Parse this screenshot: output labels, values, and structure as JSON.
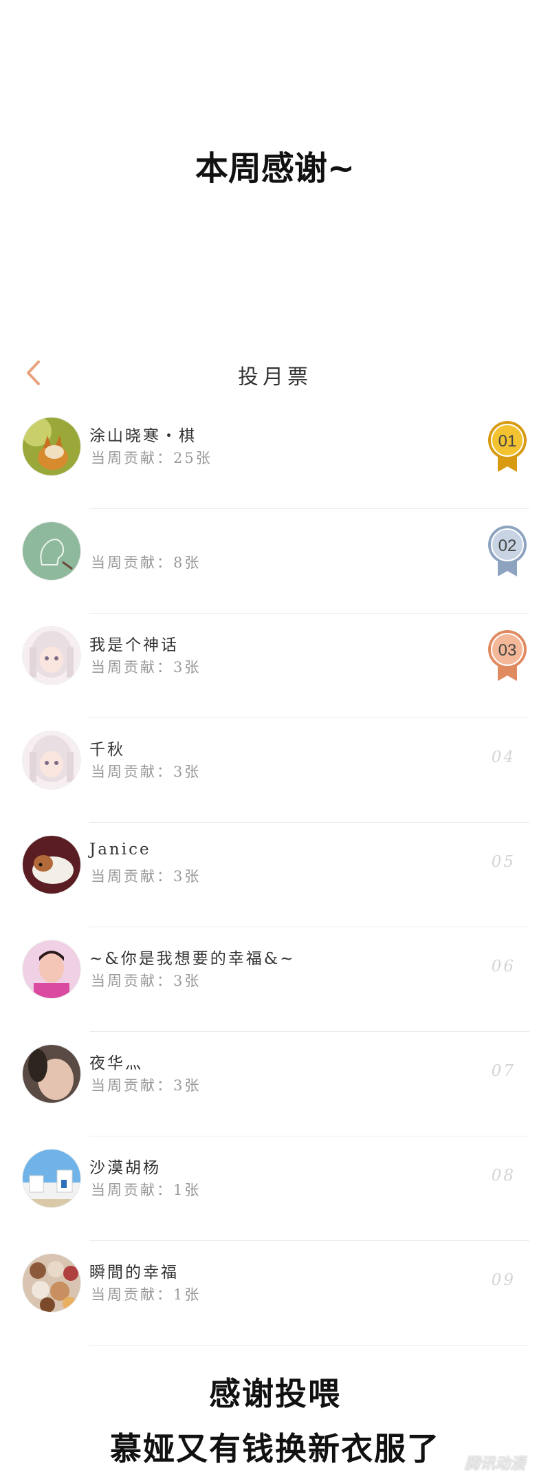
{
  "header": {
    "title": "本周感谢~"
  },
  "nav": {
    "title": "投月票"
  },
  "colors": {
    "accent": "#e8a27c",
    "gold": "#e8b020",
    "silver": "#8ea3c0",
    "bronze": "#e89a70"
  },
  "entries": [
    {
      "name": "涂山晓寒・棋",
      "contribution": "当周贡献：25张",
      "rank": "01",
      "medal": "gold",
      "avatar_icon": "fox-avatar"
    },
    {
      "name": "",
      "contribution": "当周贡献：8张",
      "rank": "02",
      "medal": "silver",
      "avatar_icon": "default-profile-avatar"
    },
    {
      "name": "我是个神话",
      "contribution": "当周贡献：3张",
      "rank": "03",
      "medal": "bronze",
      "avatar_icon": "anime-girl-avatar"
    },
    {
      "name": "千秋",
      "contribution": "当周贡献：3张",
      "rank": "04",
      "medal": "",
      "avatar_icon": "anime-girl-avatar"
    },
    {
      "name": "Janice",
      "contribution": "当周贡献：3张",
      "rank": "05",
      "medal": "",
      "avatar_icon": "guinea-pig-avatar"
    },
    {
      "name": "~&你是我想要的幸福&~",
      "contribution": "当周贡献：3张",
      "rank": "06",
      "medal": "",
      "avatar_icon": "person-photo-avatar"
    },
    {
      "name": "夜华灬",
      "contribution": "当周贡献：3张",
      "rank": "07",
      "medal": "",
      "avatar_icon": "photo-avatar"
    },
    {
      "name": "沙漠胡杨",
      "contribution": "当周贡献：1张",
      "rank": "08",
      "medal": "",
      "avatar_icon": "seaside-village-avatar"
    },
    {
      "name": "瞬間的幸福",
      "contribution": "当周贡献：1张",
      "rank": "09",
      "medal": "",
      "avatar_icon": "plush-toys-avatar"
    }
  ],
  "footer": {
    "line1": "感谢投喂",
    "line2": "慕娅又有钱换新衣服了"
  },
  "watermark": {
    "text": "腾讯动漫"
  }
}
